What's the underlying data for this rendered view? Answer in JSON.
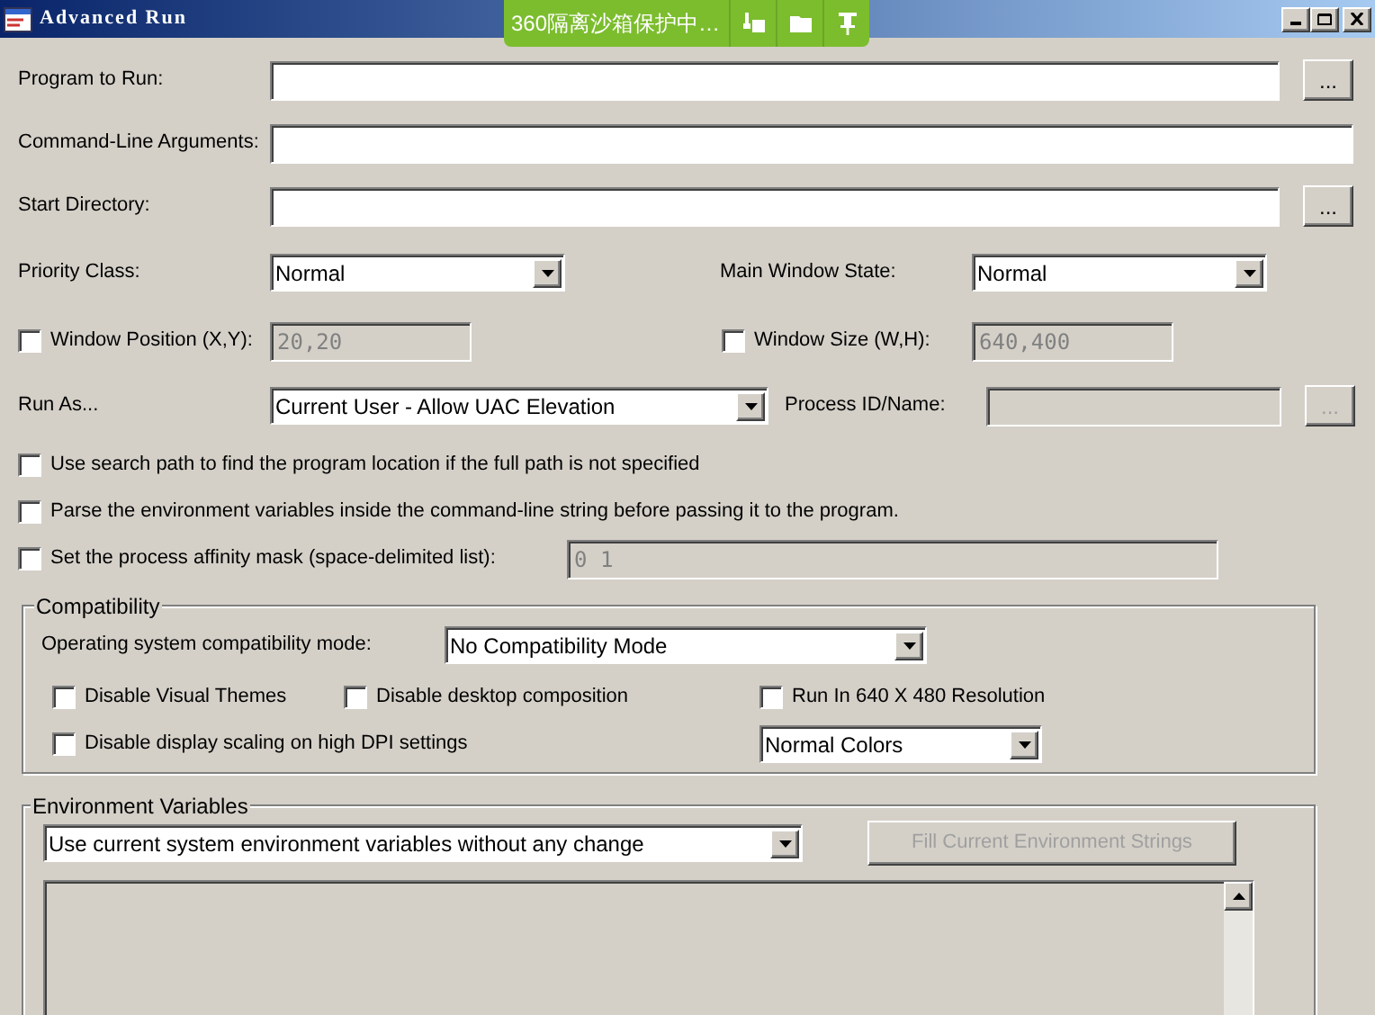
{
  "window": {
    "title": "Advanced Run"
  },
  "sandbox_bar": {
    "text": "360隔离沙箱保护中…"
  },
  "program_to_run": {
    "label": "Program to Run:",
    "browse": "..."
  },
  "command_line": {
    "label": "Command-Line Arguments:"
  },
  "start_directory": {
    "label": "Start Directory:",
    "browse": "..."
  },
  "priority_class": {
    "label": "Priority Class:",
    "value": "Normal"
  },
  "main_window_state": {
    "label": "Main Window State:",
    "value": "Normal"
  },
  "window_position": {
    "label": "Window Position (X,Y):",
    "checked": false,
    "value": "20,20",
    "disabled": true
  },
  "window_size": {
    "label": "Window Size (W,H):",
    "checked": false,
    "value": "640,400",
    "disabled": true
  },
  "run_as": {
    "label": "Run As...",
    "value": "Current User - Allow UAC Elevation"
  },
  "process_id": {
    "label": "Process ID/Name:",
    "disabled": true,
    "browse": "..."
  },
  "options": [
    {
      "label": "Use search path to find the program location if the full path is not specified",
      "checked": false
    },
    {
      "label": "Parse the environment variables inside the command-line string before passing it to the program.",
      "checked": false
    }
  ],
  "affinity": {
    "label": "Set the process affinity mask (space-delimited list):",
    "checked": false,
    "value": "0 1",
    "disabled": true
  },
  "compatibility": {
    "title": "Compatibility",
    "mode_label": "Operating system compatibility mode:",
    "mode_value": "No Compatibility Mode",
    "options": [
      {
        "label": "Disable Visual Themes",
        "checked": false
      },
      {
        "label": "Disable desktop composition",
        "checked": false
      },
      {
        "label": "Run In 640 X 480 Resolution",
        "checked": false
      },
      {
        "label": "Disable display scaling on high DPI settings",
        "checked": false
      }
    ],
    "colors": "Normal Colors"
  },
  "environment": {
    "title": "Environment Variables",
    "mode": "Use current system environment variables without any change",
    "fill_button": {
      "label": "Fill Current Environment Strings",
      "disabled": true
    }
  }
}
